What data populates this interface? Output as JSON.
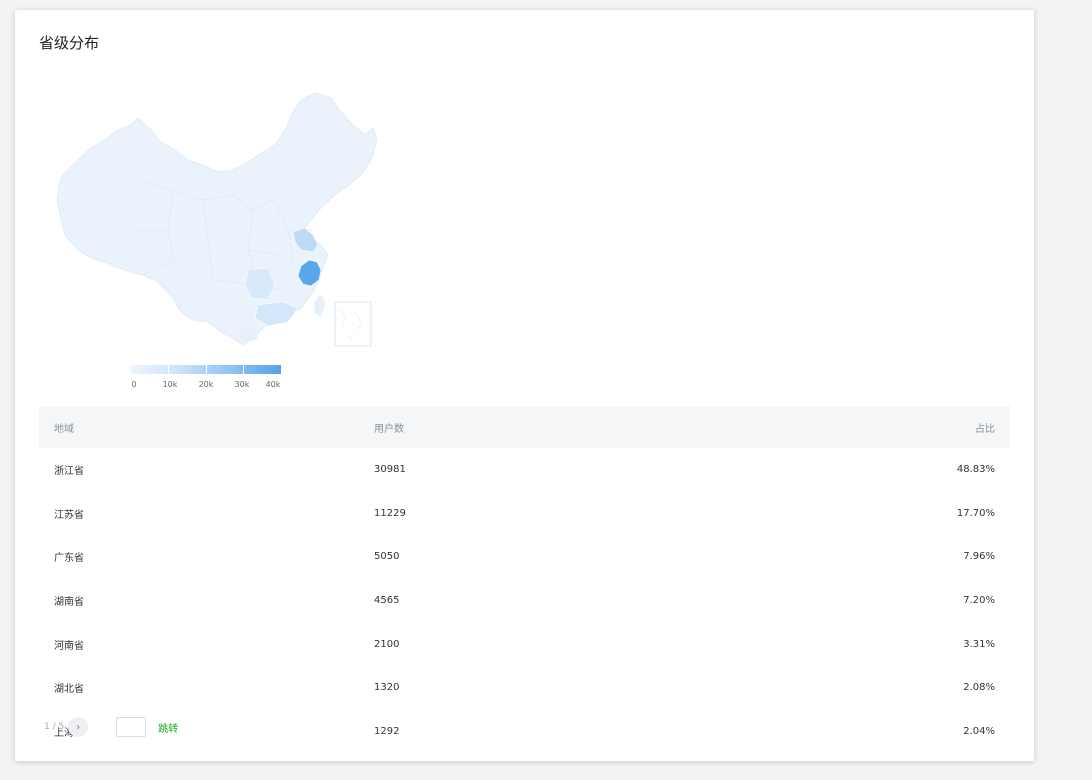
{
  "title": "省级分布",
  "colors": {
    "accent_green": "#1aad19",
    "map_high": "#55a3ea",
    "map_low": "#eef5fd"
  },
  "legend": {
    "labels": [
      "0",
      "10k",
      "20k",
      "30k",
      "40k"
    ]
  },
  "table": {
    "headers": {
      "region": "地域",
      "users": "用户数",
      "percent": "占比"
    },
    "rows": [
      {
        "region": "浙江省",
        "users": "30981",
        "percent": "48.83%"
      },
      {
        "region": "江苏省",
        "users": "11229",
        "percent": "17.70%"
      },
      {
        "region": "广东省",
        "users": "5050",
        "percent": "7.96%"
      },
      {
        "region": "湖南省",
        "users": "4565",
        "percent": "7.20%"
      },
      {
        "region": "河南省",
        "users": "2100",
        "percent": "3.31%"
      },
      {
        "region": "湖北省",
        "users": "1320",
        "percent": "2.08%"
      },
      {
        "region": "上海",
        "users": "1292",
        "percent": "2.04%"
      }
    ]
  },
  "pager": {
    "info": "1 / 5",
    "next_icon": "chevron-right-icon",
    "jump_label": "跳转"
  }
}
